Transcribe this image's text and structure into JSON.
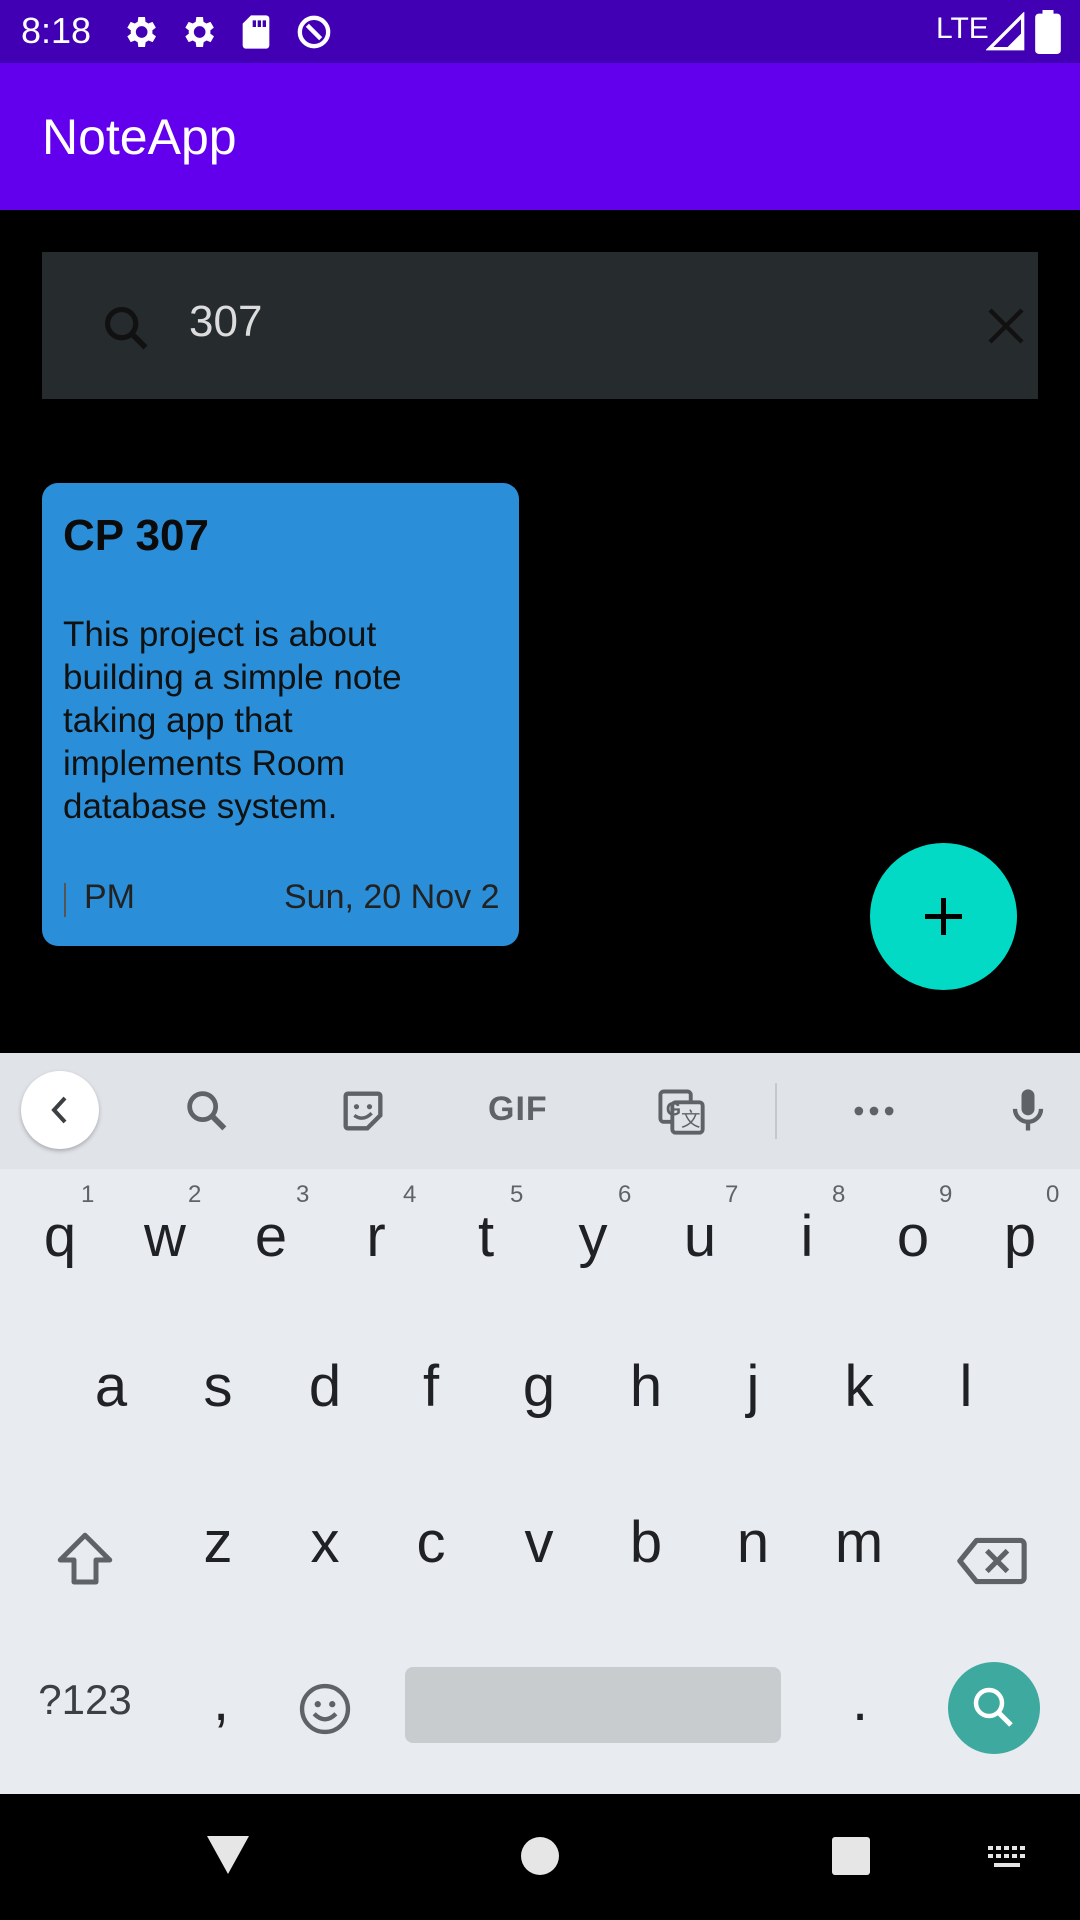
{
  "status_bar": {
    "time": "8:18",
    "network": "LTE"
  },
  "app_bar": {
    "title": "NoteApp"
  },
  "search": {
    "query": "307"
  },
  "notes": [
    {
      "title": "CP 307",
      "body": "This project is about building a simple note taking app that implements Room database system.",
      "time": "PM",
      "date": "Sun, 20 Nov 2"
    }
  ],
  "keyboard": {
    "toolbar": {
      "gif_label": "GIF"
    },
    "row1": [
      {
        "k": "q",
        "h": "1"
      },
      {
        "k": "w",
        "h": "2"
      },
      {
        "k": "e",
        "h": "3"
      },
      {
        "k": "r",
        "h": "4"
      },
      {
        "k": "t",
        "h": "5"
      },
      {
        "k": "y",
        "h": "6"
      },
      {
        "k": "u",
        "h": "7"
      },
      {
        "k": "i",
        "h": "8"
      },
      {
        "k": "o",
        "h": "9"
      },
      {
        "k": "p",
        "h": "0"
      }
    ],
    "row2": [
      "a",
      "s",
      "d",
      "f",
      "g",
      "h",
      "j",
      "k",
      "l"
    ],
    "row3": [
      "z",
      "x",
      "c",
      "v",
      "b",
      "n",
      "m"
    ],
    "symbols_label": "?123",
    "comma": ",",
    "period": "."
  },
  "colors": {
    "status_bar": "#4200b5",
    "app_bar": "#6200ee",
    "card": "#2a8fd8",
    "fab": "#03dac5",
    "search_key": "#3ea99f"
  }
}
